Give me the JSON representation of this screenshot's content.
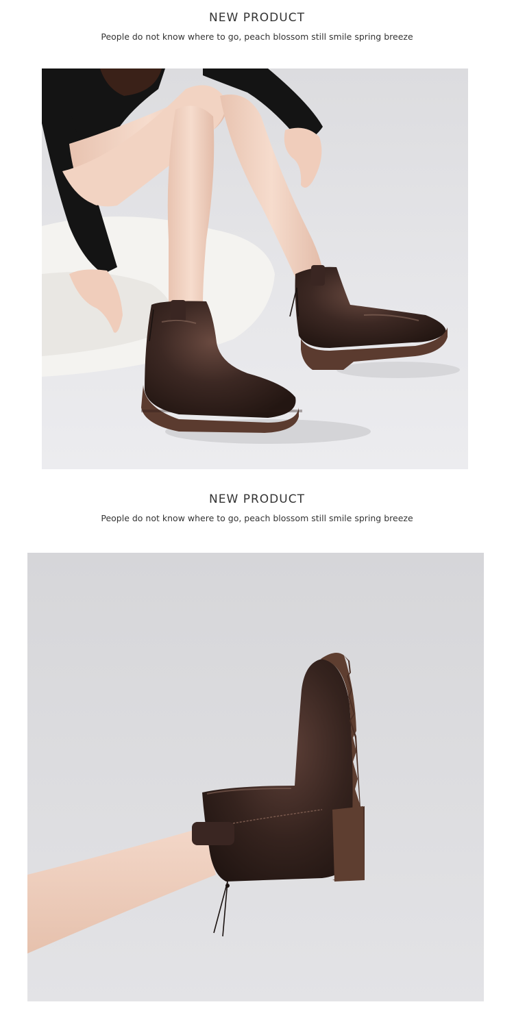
{
  "sections": [
    {
      "title": "NEW PRODUCT",
      "subtitle": "People do not know where to go, peach blossom still smile spring breeze"
    },
    {
      "title": "NEW PRODUCT",
      "subtitle": "People do not know where to go, peach blossom still smile spring breeze"
    }
  ],
  "colors": {
    "text": "#333333",
    "background_photo": "#e6e6e8",
    "boot_leather": "#3a2622",
    "boot_sole": "#5a3a2e",
    "skin": "#f1d3c2",
    "sofa": "#f3f2ef",
    "sweater": "#111111"
  }
}
